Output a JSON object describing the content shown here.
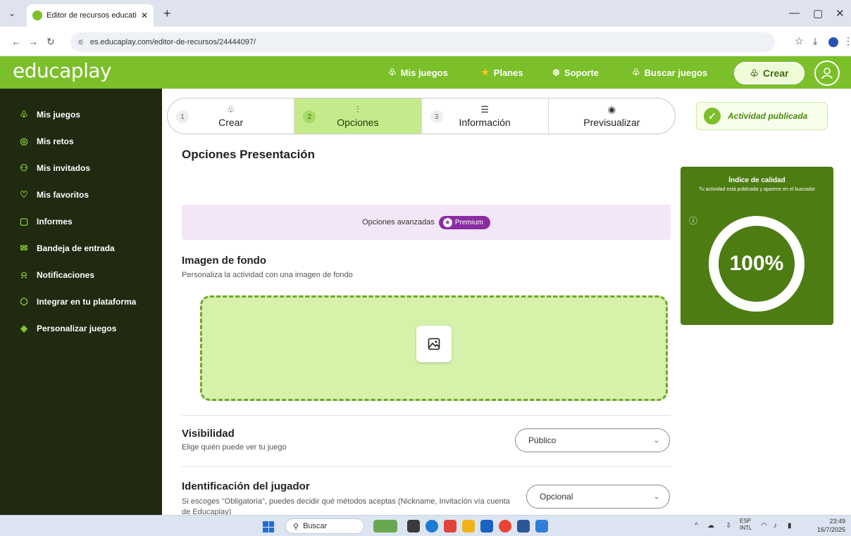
{
  "browser": {
    "tab_title": "Editor de recursos educativos: ",
    "url": "es.educaplay.com/editor-de-recursos/24444097/"
  },
  "header": {
    "logo": "educaplay",
    "nav": [
      "Mis juegos",
      "Planes",
      "Soporte",
      "Buscar juegos"
    ],
    "crear_label": "Crear"
  },
  "sidebar": {
    "items": [
      {
        "label": "Mis juegos",
        "icon": "games-icon"
      },
      {
        "label": "Mis retos",
        "icon": "target-icon"
      },
      {
        "label": "Mis invitados",
        "icon": "users-icon"
      },
      {
        "label": "Mis favoritos",
        "icon": "heart-icon"
      },
      {
        "label": "Informes",
        "icon": "report-icon"
      },
      {
        "label": "Bandeja de entrada",
        "icon": "mail-icon"
      },
      {
        "label": "Notificaciones",
        "icon": "bell-icon"
      },
      {
        "label": "Integrar en tu plataforma",
        "icon": "cube-icon"
      },
      {
        "label": "Personalizar juegos",
        "icon": "customize-icon"
      }
    ]
  },
  "stepper": {
    "steps": [
      {
        "num": "1",
        "label": "Crear"
      },
      {
        "num": "2",
        "label": "Opciones"
      },
      {
        "num": "3",
        "label": "Información"
      },
      {
        "num": "",
        "label": "Previsualizar"
      }
    ],
    "active_index": 1
  },
  "status": {
    "published": "Actividad publicada"
  },
  "main": {
    "title": "Opciones Presentación",
    "advanced": "Opciones avanzadas",
    "premium": "Premium",
    "bg_title": "Imagen de fondo",
    "bg_sub": "Personaliza la actividad con una imagen de fondo",
    "visibility_title": "Visibilidad",
    "visibility_sub": "Elige quién puede ver tu juego",
    "visibility_value": "Público",
    "ident_title": "Identificación del jugador",
    "ident_sub": "Si escoges \"Obligatoria\", puedes decidir qué métodos aceptas (Nickname, Invitación vía cuenta de Educaplay)",
    "ident_value": "Opcional"
  },
  "quality": {
    "title": "Índice de calidad",
    "subtitle": "Tu actividad está publicada y aparece en el buscador",
    "value": "100%",
    "fraction": 1.0
  },
  "taskbar": {
    "search": "Buscar",
    "lang1": "ESP",
    "lang2": "INTL",
    "time": "23:49",
    "date": "16/7/2025"
  },
  "colors": {
    "brand_green": "#7bbf2a",
    "sidebar_bg": "#1f2a10",
    "active_step": "#c5ea8b",
    "premium_purple": "#8a2ca1",
    "quality_bg": "#4d7c13"
  }
}
